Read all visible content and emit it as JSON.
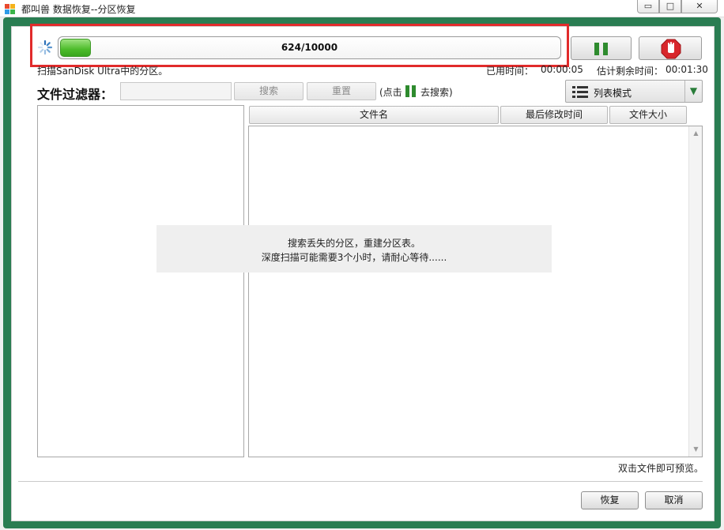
{
  "window": {
    "title": "都叫兽 数据恢复--分区恢复",
    "minimize_glyph": "▭",
    "maximize_glyph": "□",
    "close_glyph": "✕"
  },
  "scan": {
    "progress_text": "624/10000",
    "progress_fraction": 0.0624,
    "scan_message": "扫描SanDisk Ultra中的分区。",
    "elapsed_label": "已用时间：",
    "elapsed_value": "00:00:05",
    "remaining_label": "估计剩余时间：",
    "remaining_value": "00:01:30"
  },
  "filter": {
    "label": "文件过滤器：",
    "input_value": "",
    "search_label": "搜索",
    "reset_label": "重置",
    "hint_before": "(点击",
    "hint_after": "去搜索)"
  },
  "view_mode": {
    "label": "列表模式",
    "dropdown_glyph": "▼"
  },
  "file_list": {
    "columns": [
      "文件名",
      "最后修改时间",
      "文件大小"
    ]
  },
  "status": {
    "line1": "搜索丢失的分区，重建分区表。",
    "line2": "深度扫描可能需要3个小时，请耐心等待......"
  },
  "footer": {
    "preview_hint": "双击文件即可预览。",
    "recover_label": "恢复",
    "cancel_label": "取消"
  },
  "colors": {
    "frame_green": "#2a7d52",
    "progress_green": "#4cbb2a",
    "highlight_red": "#e12b2b",
    "stop_red": "#d8262b"
  },
  "icons": {
    "app": "app-logo-icon",
    "spinner": "loading-spinner-icon",
    "pause": "pause-icon",
    "stop": "stop-hand-icon",
    "list": "list-view-icon"
  }
}
